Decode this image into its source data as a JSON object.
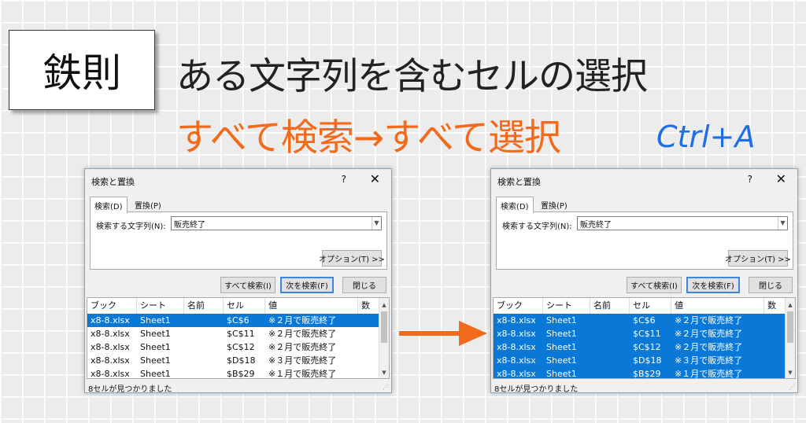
{
  "slide": {
    "badge": "鉄則",
    "title": "ある文字列を含むセルの選択",
    "subtitle": "すべて検索→すべて選択",
    "shortcut": "Ctrl+A",
    "colors": {
      "subtitle": "#f26b1d",
      "shortcut": "#1e6fe6",
      "arrow": "#f26b1d",
      "selection": "#0a78d7"
    }
  },
  "dialogs": [
    {
      "title": "検索と置換",
      "help": "?",
      "tabs": [
        "検索(D)",
        "置換(P)"
      ],
      "find_label": "検索する文字列(N):",
      "find_value": "販売終了",
      "options_button": "オプション(T) >>",
      "buttons": {
        "find_all": "すべて検索(I)",
        "find_next": "次を検索(F)",
        "close": "閉じる"
      },
      "columns": [
        "ブック",
        "シート",
        "名前",
        "セル",
        "値",
        "数"
      ],
      "rows": [
        {
          "book": "x8-8.xlsx",
          "sheet": "Sheet1",
          "name": "",
          "cell": "$C$6",
          "value": "※２月で販売終了",
          "selected": true
        },
        {
          "book": "x8-8.xlsx",
          "sheet": "Sheet1",
          "name": "",
          "cell": "$C$11",
          "value": "※２月で販売終了",
          "selected": false
        },
        {
          "book": "x8-8.xlsx",
          "sheet": "Sheet1",
          "name": "",
          "cell": "$C$12",
          "value": "※２月で販売終了",
          "selected": false
        },
        {
          "book": "x8-8.xlsx",
          "sheet": "Sheet1",
          "name": "",
          "cell": "$D$18",
          "value": "※３月で販売終了",
          "selected": false
        },
        {
          "book": "x8-8.xlsx",
          "sheet": "Sheet1",
          "name": "",
          "cell": "$B$29",
          "value": "※１月で販売終了",
          "selected": false
        }
      ],
      "status": "8セルが見つかりました"
    },
    {
      "title": "検索と置換",
      "help": "?",
      "tabs": [
        "検索(D)",
        "置換(P)"
      ],
      "find_label": "検索する文字列(N):",
      "find_value": "販売終了",
      "options_button": "オプション(T) >>",
      "buttons": {
        "find_all": "すべて検索(I)",
        "find_next": "次を検索(F)",
        "close": "閉じる"
      },
      "columns": [
        "ブック",
        "シート",
        "名前",
        "セル",
        "値",
        "数"
      ],
      "rows": [
        {
          "book": "x8-8.xlsx",
          "sheet": "Sheet1",
          "name": "",
          "cell": "$C$6",
          "value": "※２月で販売終了",
          "selected": true
        },
        {
          "book": "x8-8.xlsx",
          "sheet": "Sheet1",
          "name": "",
          "cell": "$C$11",
          "value": "※２月で販売終了",
          "selected": true
        },
        {
          "book": "x8-8.xlsx",
          "sheet": "Sheet1",
          "name": "",
          "cell": "$C$12",
          "value": "※２月で販売終了",
          "selected": true
        },
        {
          "book": "x8-8.xlsx",
          "sheet": "Sheet1",
          "name": "",
          "cell": "$D$18",
          "value": "※３月で販売終了",
          "selected": true
        },
        {
          "book": "x8-8.xlsx",
          "sheet": "Sheet1",
          "name": "",
          "cell": "$B$29",
          "value": "※１月で販売終了",
          "selected": true
        }
      ],
      "status": "8セルが見つかりました"
    }
  ]
}
